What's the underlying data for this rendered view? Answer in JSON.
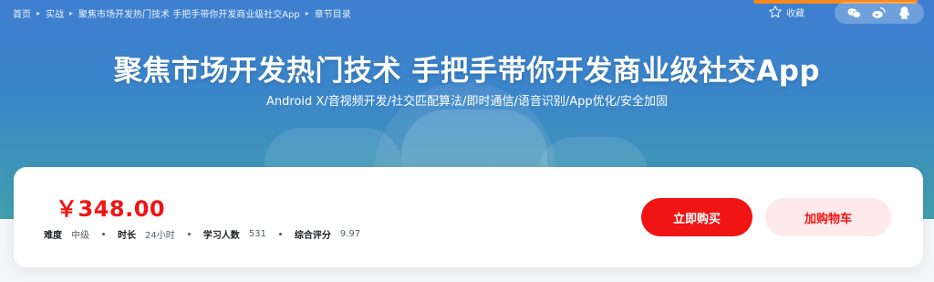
{
  "breadcrumb": [
    "首页",
    "实战",
    "聚焦市场开发热门技术 手把手带你开发商业级社交App",
    "章节目录"
  ],
  "toolbar": {
    "collect_label": "收藏"
  },
  "share_icons": [
    "wechat-icon",
    "weibo-icon",
    "qq-icon"
  ],
  "course": {
    "title": "聚焦市场开发热门技术 手把手带你开发商业级社交App",
    "subtitle": "Android X/音视频开发/社交匹配算法/即时通信/语音识别/App优化/安全加固"
  },
  "purchase": {
    "price": "￥348.00",
    "meta": [
      {
        "key": "难度",
        "value": "中级"
      },
      {
        "key": "时长",
        "value": "24小时"
      },
      {
        "key": "学习人数",
        "value": "531"
      },
      {
        "key": "综合评分",
        "value": "9.97"
      }
    ],
    "buy_label": "立即购买",
    "cart_label": "加购物车"
  },
  "colors": {
    "accent": "#f01414",
    "cart_bg": "#fde9e9",
    "hero_top": "#3e7fd0",
    "hero_bottom": "#42a0ad"
  }
}
